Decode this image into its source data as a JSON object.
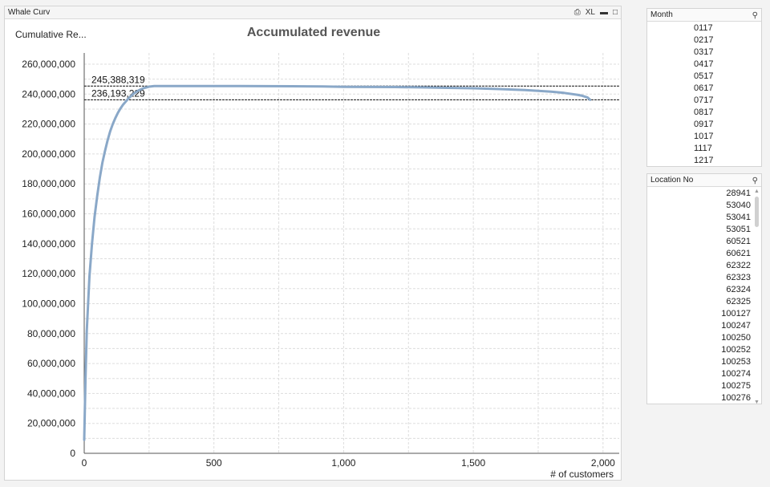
{
  "window": {
    "title": "Whale Curv",
    "icons": [
      "print-icon",
      "xl-export-icon",
      "minimize-icon",
      "maximize-icon"
    ],
    "xl_label": "XL"
  },
  "chart_header": {
    "expression_label": "Cumulative Re..."
  },
  "chart_data": {
    "type": "line",
    "title": "Accumulated revenue",
    "xlabel": "# of customers",
    "ylabel": "",
    "xlim": [
      0,
      2050
    ],
    "ylim": [
      0,
      260000000
    ],
    "x_ticks": [
      0,
      500,
      1000,
      1500,
      2000
    ],
    "x_tick_labels": [
      "0",
      "500",
      "1,000",
      "1,500",
      "2,000"
    ],
    "y_ticks": [
      0,
      20000000,
      40000000,
      60000000,
      80000000,
      100000000,
      120000000,
      140000000,
      160000000,
      180000000,
      200000000,
      220000000,
      240000000,
      260000000
    ],
    "y_tick_labels": [
      "0",
      "20,000,000",
      "40,000,000",
      "60,000,000",
      "80,000,000",
      "100,000,000",
      "120,000,000",
      "140,000,000",
      "160,000,000",
      "180,000,000",
      "200,000,000",
      "220,000,000",
      "240,000,000",
      "260,000,000"
    ],
    "grid": true,
    "series": [
      {
        "color": "#8aa8c8",
        "x": [
          0,
          5,
          10,
          20,
          30,
          40,
          50,
          60,
          70,
          80,
          90,
          100,
          110,
          120,
          130,
          140,
          150,
          170,
          190,
          210,
          230,
          250,
          270,
          300,
          400,
          600,
          800,
          920,
          1000,
          1200,
          1300,
          1400,
          1500,
          1600,
          1700,
          1800,
          1850,
          1900,
          1920,
          1940,
          1950
        ],
        "y": [
          9000000,
          50000000,
          82000000,
          118000000,
          140000000,
          158000000,
          172000000,
          184000000,
          194000000,
          202000000,
          209000000,
          215000000,
          220000000,
          224000000,
          227500000,
          230500000,
          233000000,
          237000000,
          240200000,
          242500000,
          244000000,
          245000000,
          245388319,
          245388319,
          245388319,
          245350000,
          245250000,
          245100000,
          244900000,
          244700000,
          244500000,
          244200000,
          243900000,
          243400000,
          242700000,
          241600000,
          240800000,
          239600000,
          238900000,
          237800000,
          236193229
        ]
      }
    ],
    "reference_lines": [
      {
        "label": "245,388,319",
        "value": 245388319
      },
      {
        "label": "236,193,229",
        "value": 236193229
      }
    ]
  },
  "month_list": {
    "title": "Month",
    "items": [
      "0117",
      "0217",
      "0317",
      "0417",
      "0517",
      "0617",
      "0717",
      "0817",
      "0917",
      "1017",
      "1117",
      "1217"
    ]
  },
  "location_list": {
    "title": "Location No",
    "items": [
      "28941",
      "53040",
      "53041",
      "53051",
      "60521",
      "60621",
      "62322",
      "62323",
      "62324",
      "62325",
      "100127",
      "100247",
      "100250",
      "100252",
      "100253",
      "100274",
      "100275",
      "100276"
    ],
    "scroll_up": "▲",
    "scroll_down": "▼"
  }
}
